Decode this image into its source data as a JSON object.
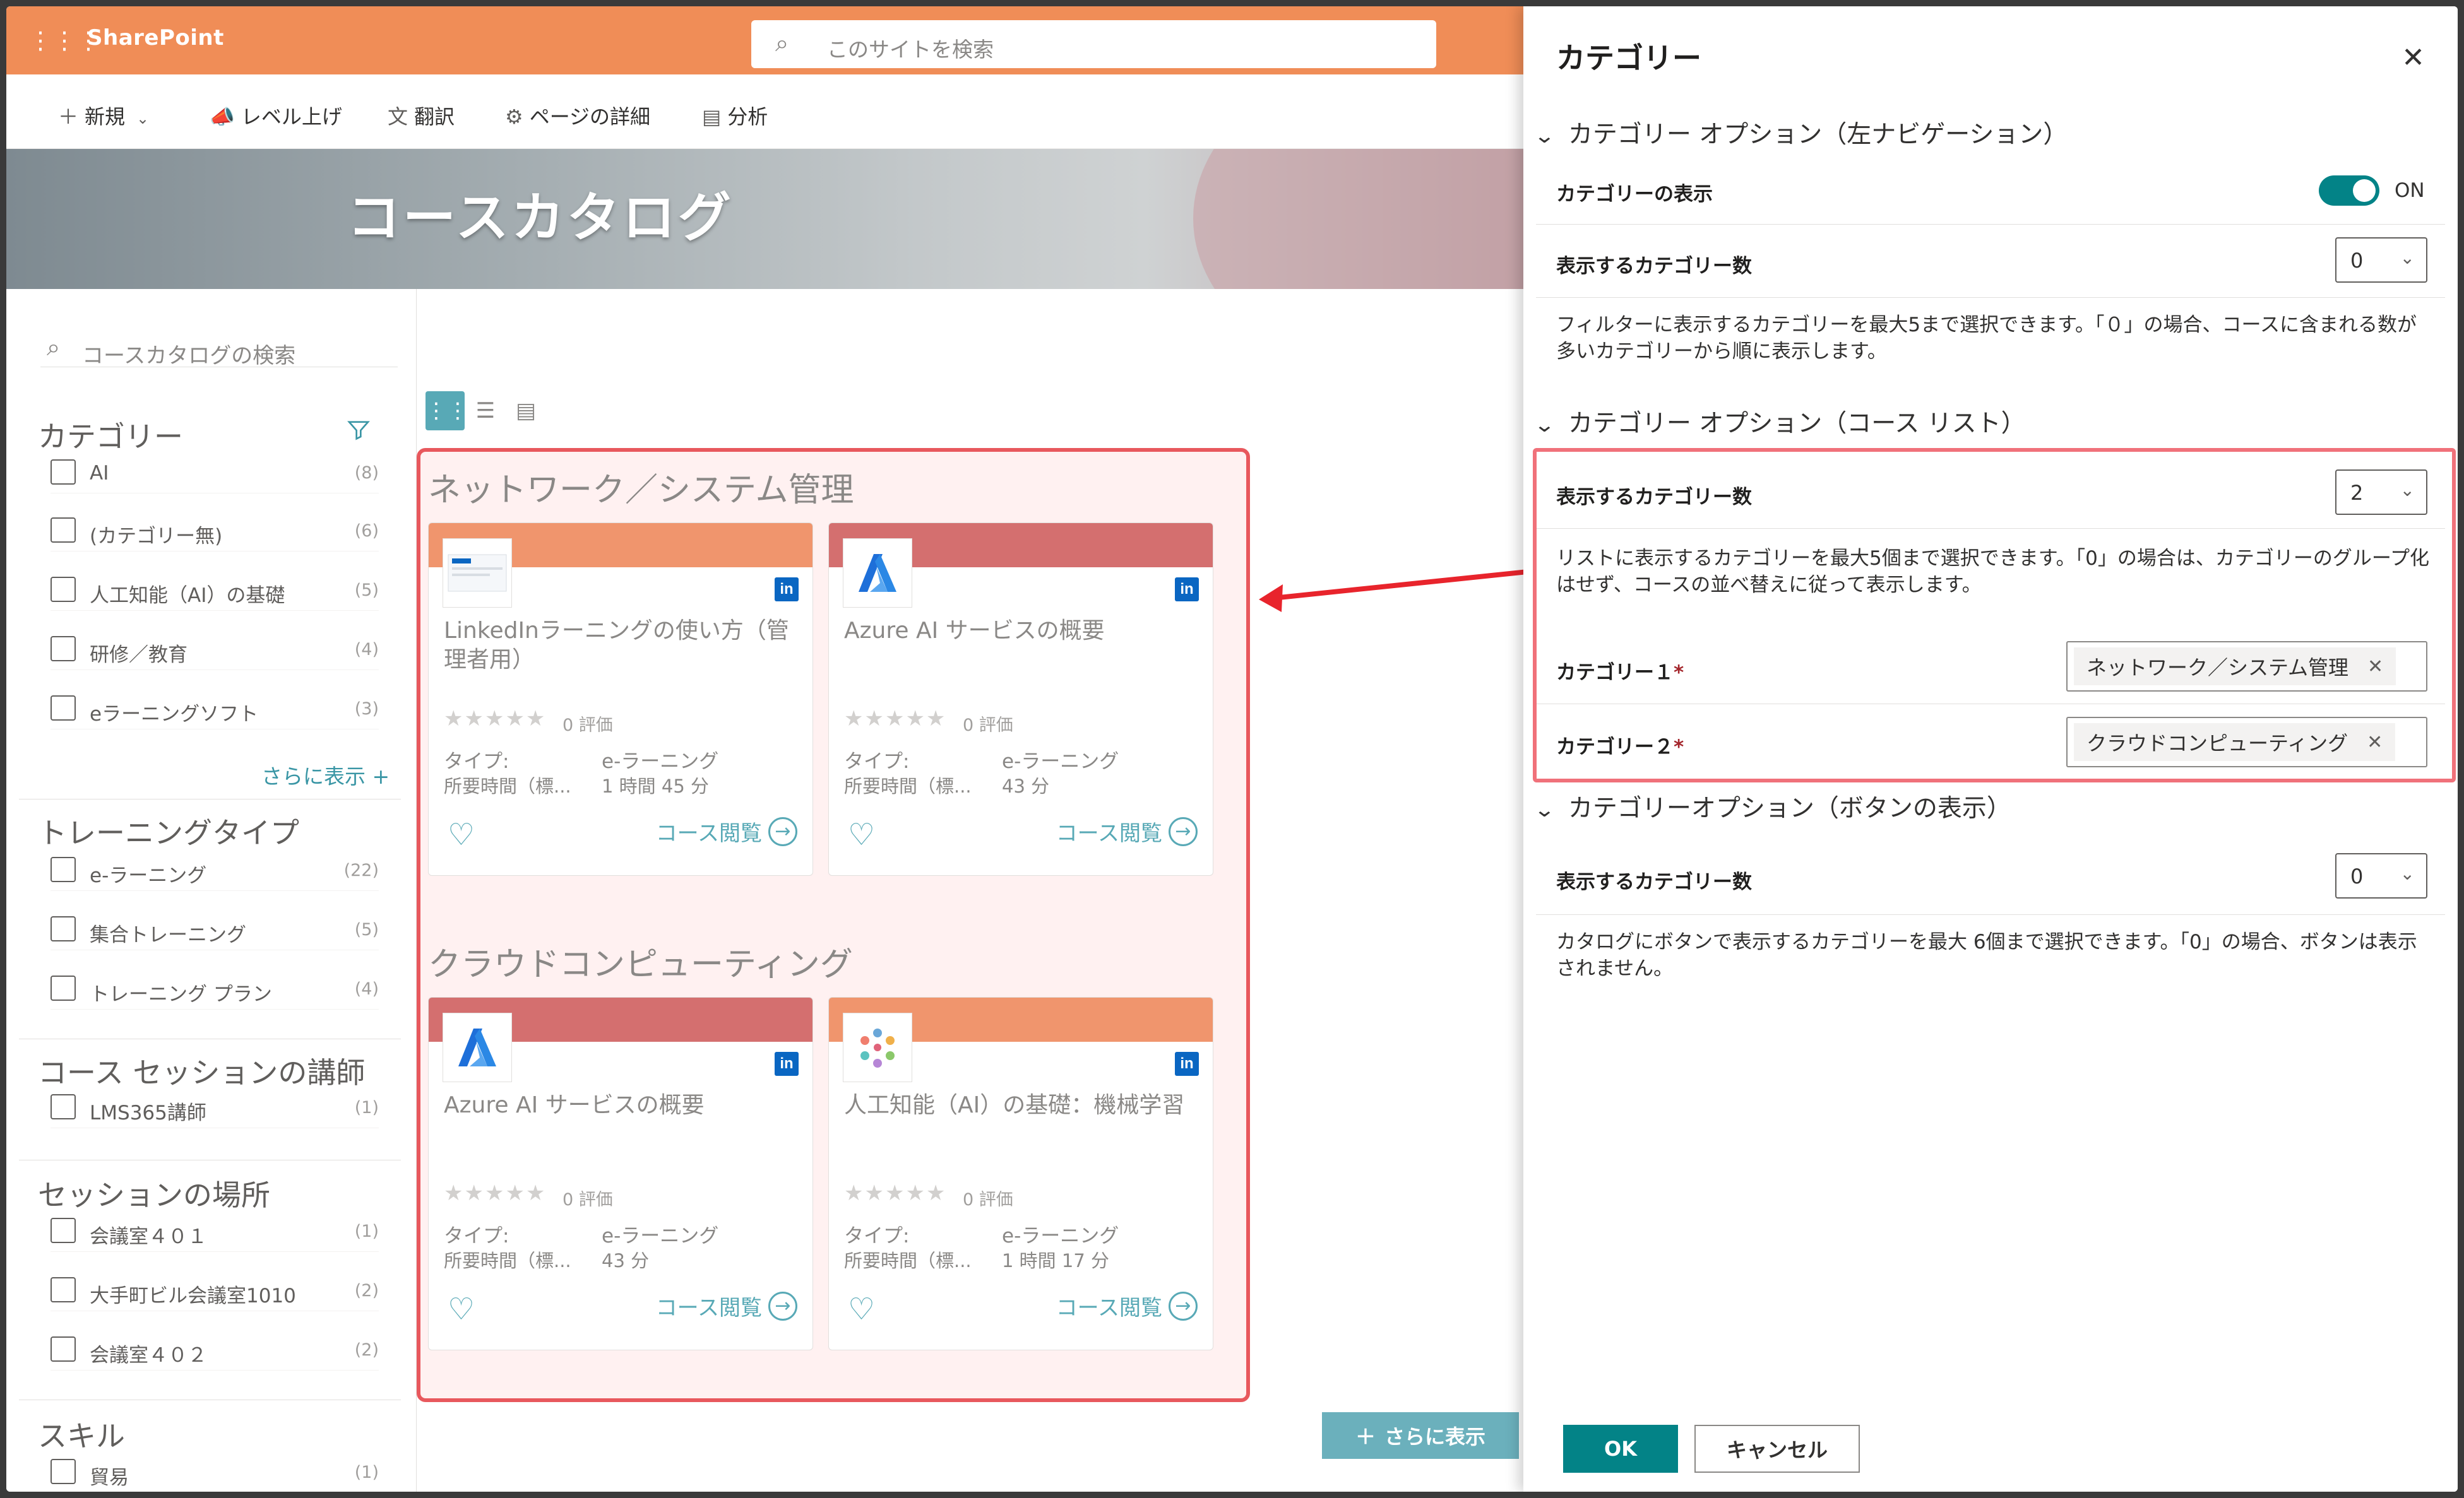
{
  "suitebar": {
    "app_name": "SharePoint",
    "search_placeholder": "このサイトを検索",
    "color": "#f08d57"
  },
  "commandbar": {
    "new": "新規",
    "promote": "レベル上げ",
    "translate": "翻訳",
    "page_details": "ページの詳細",
    "analytics": "分析"
  },
  "hero": {
    "title": "コースカタログ"
  },
  "left": {
    "search_placeholder": "コースカタログの検索",
    "category": {
      "title": "カテゴリー",
      "items": [
        {
          "label": "AI",
          "count": "(8)"
        },
        {
          "label": "(カテゴリー無)",
          "count": "(6)"
        },
        {
          "label": "人工知能（AI）の基礎",
          "count": "(5)"
        },
        {
          "label": "研修／教育",
          "count": "(4)"
        },
        {
          "label": "eラーニングソフト",
          "count": "(3)"
        }
      ],
      "more": "さらに表示 +"
    },
    "training": {
      "title": "トレーニングタイプ",
      "items": [
        {
          "label": "e-ラーニング",
          "count": "(22)"
        },
        {
          "label": "集合トレーニング",
          "count": "(5)"
        },
        {
          "label": "トレーニング プラン",
          "count": "(4)"
        }
      ]
    },
    "instructor": {
      "title": "コース セッションの講師",
      "items": [
        {
          "label": "LMS365講師",
          "count": "(1)"
        }
      ]
    },
    "location": {
      "title": "セッションの場所",
      "items": [
        {
          "label": "会議室４０１",
          "count": "(1)"
        },
        {
          "label": "大手町ビル会議室1010",
          "count": "(2)"
        },
        {
          "label": "会議室４０２",
          "count": "(2)"
        }
      ]
    },
    "skill": {
      "title": "スキル",
      "items": [
        {
          "label": "貿易",
          "count": "(1)"
        }
      ]
    }
  },
  "groups": [
    {
      "title": "ネットワーク／システム管理",
      "cards": [
        {
          "title": "LinkedInラーニングの使い方（管理者用）",
          "rating": "0 評価",
          "type_label": "タイプ:",
          "type": "e-ラーニング",
          "duration_label": "所要時間（標...",
          "duration": "1 時間 45 分",
          "open": "コース閲覧",
          "band": "#f0956d"
        },
        {
          "title": "Azure AI サービスの概要",
          "rating": "0 評価",
          "type_label": "タイプ:",
          "type": "e-ラーニング",
          "duration_label": "所要時間（標...",
          "duration": "43 分",
          "open": "コース閲覧",
          "band": "#d46f6f"
        }
      ]
    },
    {
      "title": "クラウドコンピューティング",
      "cards": [
        {
          "title": "Azure AI サービスの概要",
          "rating": "0 評価",
          "type_label": "タイプ:",
          "type": "e-ラーニング",
          "duration_label": "所要時間（標...",
          "duration": "43 分",
          "open": "コース閲覧",
          "band": "#d46f6f"
        },
        {
          "title": "人工知能（AI）の基礎：機械学習",
          "rating": "0 評価",
          "type_label": "タイプ:",
          "type": "e-ラーニング",
          "duration_label": "所要時間（標...",
          "duration": "1 時間 17 分",
          "open": "コース閲覧",
          "band": "#f0956d"
        }
      ]
    }
  ],
  "show_more": "さらに表示",
  "panel": {
    "title": "カテゴリー",
    "sec1": {
      "title": "カテゴリー オプション（左ナビゲーション）",
      "show_label": "カテゴリーの表示",
      "toggle_state": "ON",
      "count_label": "表示するカテゴリー数",
      "count_value": "0",
      "desc": "フィルターに表示するカテゴリーを最大5まで選択できます。「０」の場合、コースに含まれる数が多いカテゴリーから順に表示します。"
    },
    "sec2": {
      "title": "カテゴリー オプション（コース リスト）",
      "count_label": "表示するカテゴリー数",
      "count_value": "2",
      "desc": "リストに表示するカテゴリーを最大5個まで選択できます。「0」の場合は、カテゴリーのグループ化はせず、コースの並べ替えに従って表示します。",
      "cat1_label": "カテゴリー１",
      "cat1_value": "ネットワーク／システム管理",
      "cat2_label": "カテゴリー２",
      "cat2_value": "クラウドコンピューティング",
      "required": "*"
    },
    "sec3": {
      "title": "カテゴリーオプション（ボタンの表示）",
      "count_label": "表示するカテゴリー数",
      "count_value": "0",
      "desc": "カタログにボタンで表示するカテゴリーを最大 6個まで選択できます。「0」の場合、ボタンは表示されません。"
    },
    "ok": "OK",
    "cancel": "キャンセル"
  }
}
